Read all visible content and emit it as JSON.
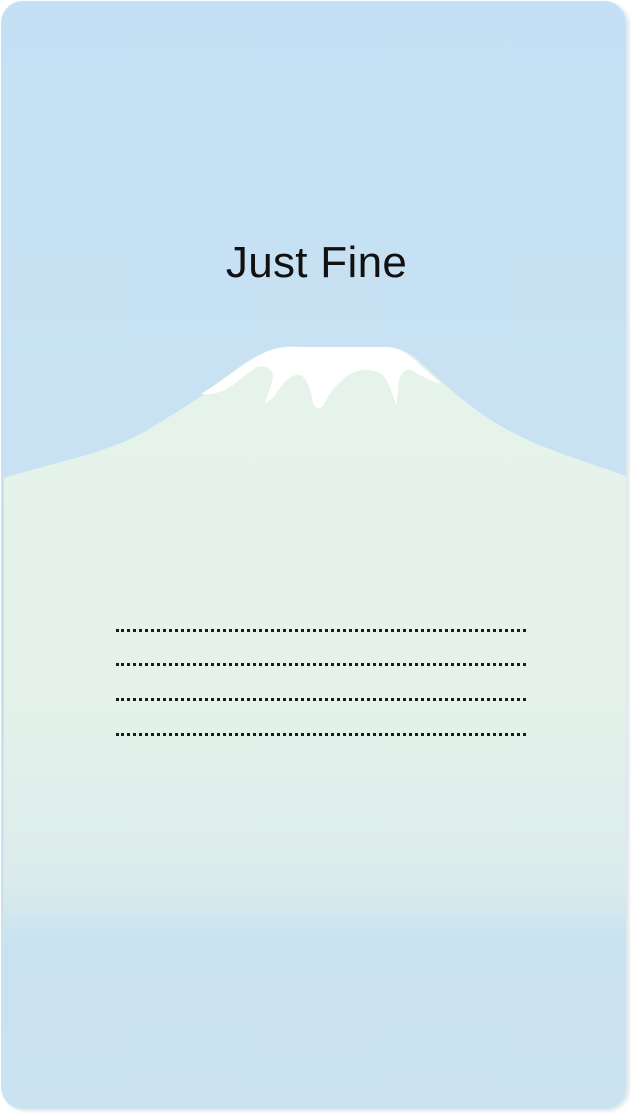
{
  "card": {
    "title": "Just Fine",
    "illustration_icon": "snow-capped-mountain-icon",
    "writing_lines": [
      "",
      "",
      "",
      ""
    ]
  },
  "colors": {
    "sky": "#c5e0f4",
    "mountain_top": "#e6f3ea",
    "snow": "#ffffff",
    "text": "#111111",
    "dots": "#1a1a1a"
  }
}
